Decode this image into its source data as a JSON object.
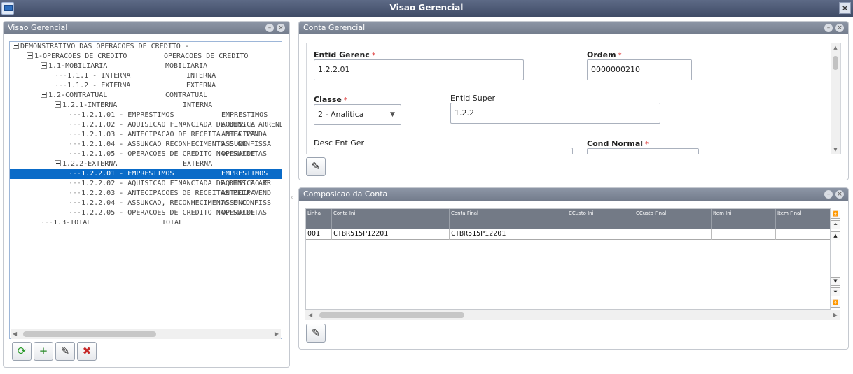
{
  "window": {
    "title": "Visao Gerencial"
  },
  "left_panel": {
    "title": "Visao Gerencial",
    "tree": [
      {
        "level": 0,
        "label": "DEMONSTRATIVO DAS OPERACOES DE CREDITO -",
        "desc": "",
        "expander": true,
        "selected": false
      },
      {
        "level": 1,
        "label": "1-OPERACOES DE CREDITO",
        "desc": "OPERACOES DE CREDITO",
        "expander": true,
        "selected": false
      },
      {
        "level": 2,
        "label": "1.1-MOBILIARIA",
        "desc": "MOBILIARIA",
        "expander": true,
        "selected": false
      },
      {
        "level": 3,
        "label": "1.1.1 - INTERNA",
        "desc": "INTERNA",
        "expander": false,
        "selected": false
      },
      {
        "level": 3,
        "label": "1.1.2 - EXTERNA",
        "desc": "EXTERNA",
        "expander": false,
        "selected": false
      },
      {
        "level": 2,
        "label": "1.2-CONTRATUAL",
        "desc": "CONTRATUAL",
        "expander": true,
        "selected": false
      },
      {
        "level": 3,
        "label": "1.2.1-INTERNA",
        "desc": "INTERNA",
        "expander": true,
        "selected": false
      },
      {
        "level": 4,
        "label": "1.2.1.01 - EMPRESTIMOS",
        "desc": "EMPRESTIMOS",
        "expander": false,
        "selected": false
      },
      {
        "level": 4,
        "label": "1.2.1.02 - AQUISICAO FINANCIADA DE BENS E ARREND",
        "desc": "AQUISICA",
        "expander": false,
        "selected": false
      },
      {
        "level": 4,
        "label": "1.2.1.03 - ANTECIPACAO DE RECEITA PELA VENDA",
        "desc": "ANTECIPA",
        "expander": false,
        "selected": false
      },
      {
        "level": 4,
        "label": "1.2.1.04 - ASSUNCAO RECONHECIMENTO E CONFISSA",
        "desc": "ASSUNC",
        "expander": false,
        "selected": false
      },
      {
        "level": 4,
        "label": "1.2.1.05 - OPERACOES DE CREDITO NAO SUJEITAS",
        "desc": "OPERACOE",
        "expander": false,
        "selected": false
      },
      {
        "level": 3,
        "label": "1.2.2-EXTERNA",
        "desc": "EXTERNA",
        "expander": true,
        "selected": false
      },
      {
        "level": 4,
        "label": "1.2.2.01 - EMPRESTIMOS",
        "desc": "EMPRESTIMOS",
        "expander": false,
        "selected": true
      },
      {
        "level": 4,
        "label": "1.2.2.02 - AQUISICAO FINANCIADA DE BENS E ARR",
        "desc": "AQUISICAO F",
        "expander": false,
        "selected": false
      },
      {
        "level": 4,
        "label": "1.2.2.03 - ANTECIPACOES DE RECEITAS PELA VEND",
        "desc": "ANTECIPA",
        "expander": false,
        "selected": false
      },
      {
        "level": 4,
        "label": "1.2.2.04 - ASSUNCAO, RECONHECIMENTO E CONFISS",
        "desc": "ASSUNC",
        "expander": false,
        "selected": false
      },
      {
        "level": 4,
        "label": "1.2.2.05 - OPERACOES DE CREDITO NAO SUJEITAS",
        "desc": "OPERACOE",
        "expander": false,
        "selected": false
      },
      {
        "level": 2,
        "label": "1.3-TOTAL",
        "desc": "TOTAL",
        "expander": false,
        "selected": false
      }
    ],
    "toolbar": [
      {
        "name": "refresh-button",
        "icon": "refresh-icon",
        "glyph": "⟳"
      },
      {
        "name": "add-button",
        "icon": "add-document-icon",
        "glyph": "+"
      },
      {
        "name": "edit-button",
        "icon": "edit-icon",
        "glyph": "✎"
      },
      {
        "name": "delete-button",
        "icon": "delete-icon",
        "glyph": "✖"
      }
    ]
  },
  "conta_panel": {
    "title": "Conta Gerencial",
    "entid_gerenc_label": "Entid Gerenc",
    "entid_gerenc_value": "1.2.2.01",
    "ordem_label": "Ordem",
    "ordem_value": "0000000210",
    "classe_label": "Classe",
    "classe_value": "2 - Analitica",
    "entid_super_label": "Entid Super",
    "entid_super_value": "1.2.2",
    "desc_ent_ger_label": "Desc Ent Ger",
    "cond_normal_label": "Cond Normal",
    "required_mark": "*",
    "edit_icon": "edit-icon"
  },
  "composicao_panel": {
    "title": "Composicao da Conta",
    "columns": [
      "Linha",
      "Conta Ini",
      "Conta Final",
      "CCusto Ini",
      "CCusto Final",
      "Item Ini",
      "Item Final"
    ],
    "rows": [
      [
        "001",
        "CTBR515P12201",
        "CTBR515P12201",
        "",
        "",
        "",
        ""
      ]
    ],
    "edit_icon": "edit-icon"
  },
  "colors": {
    "selection": "#0a6bc8",
    "panel_header": "#7f8899",
    "title_bar": "#4a5673",
    "grid_header": "#737a86"
  }
}
